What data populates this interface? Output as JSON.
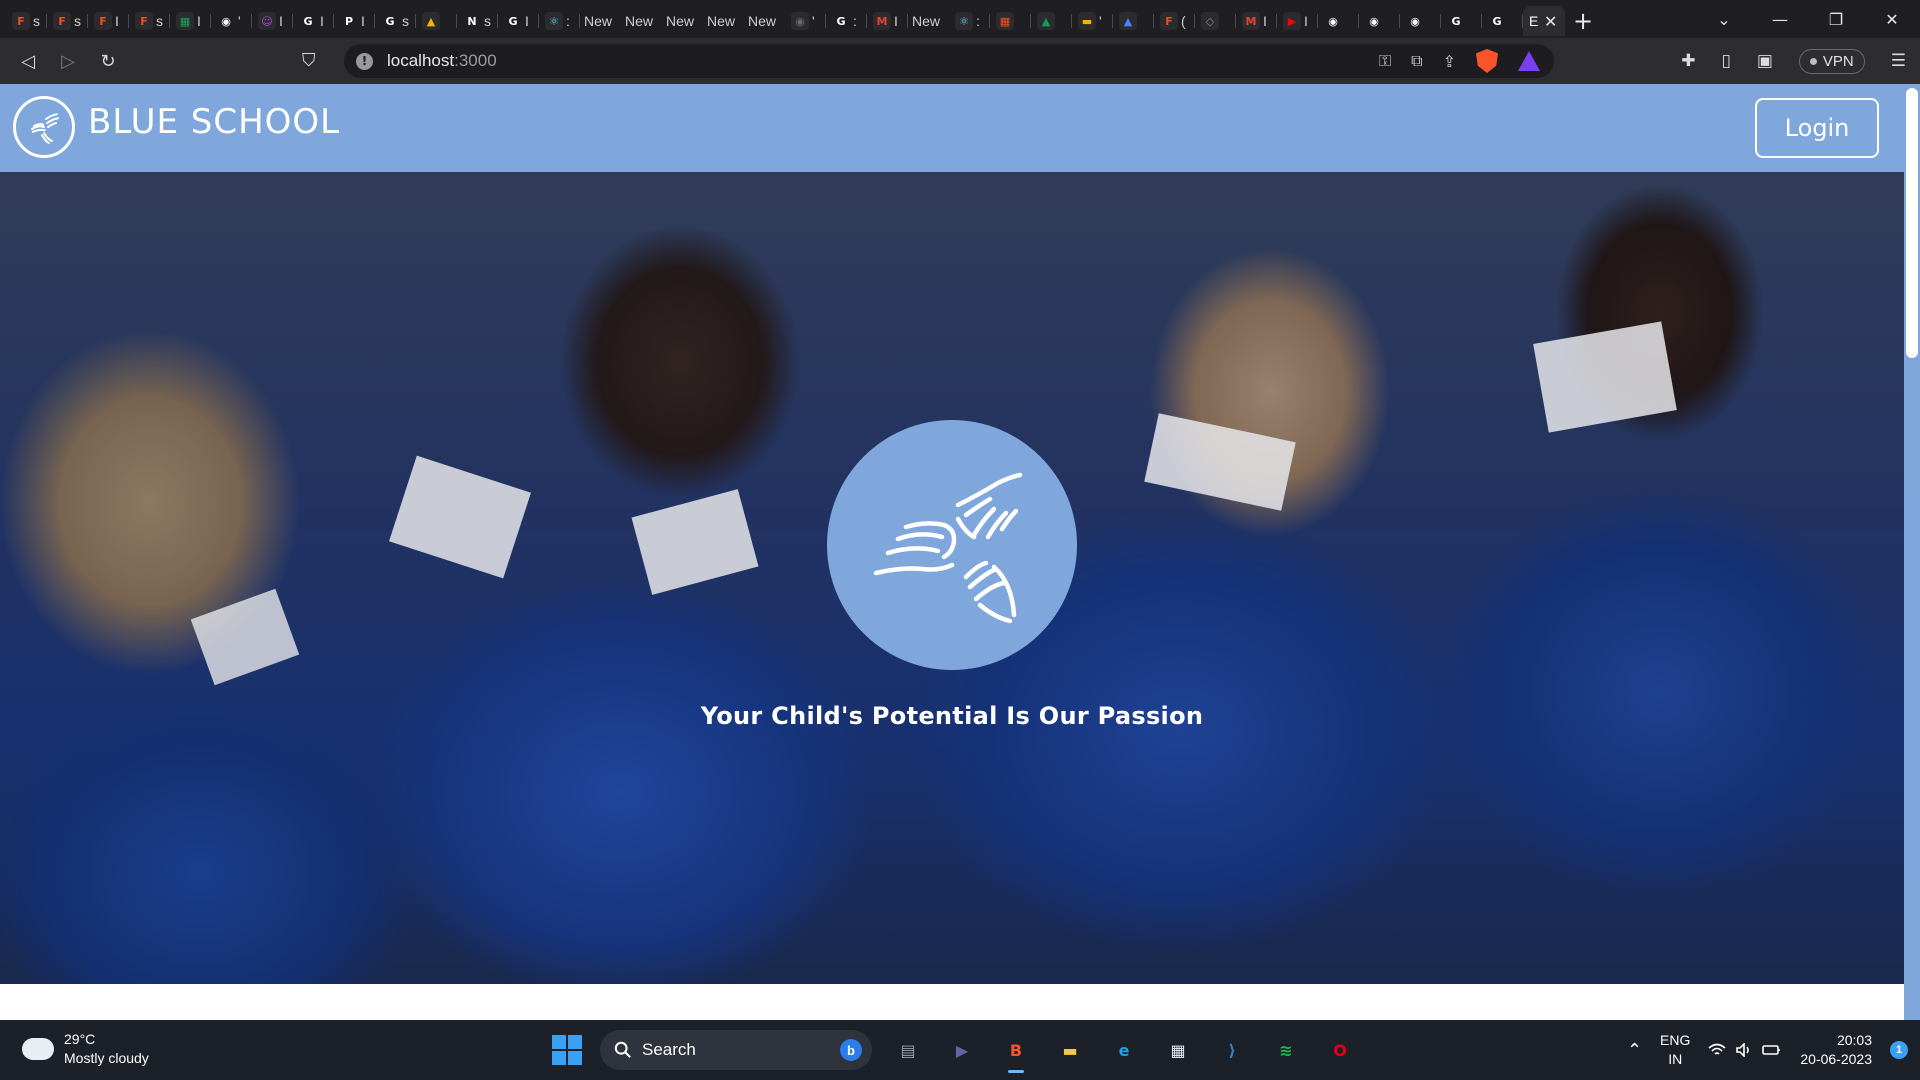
{
  "browser": {
    "tabs": [
      {
        "icon": "figma-icon",
        "color": "#f24e1e",
        "letter": "F",
        "label": "s"
      },
      {
        "icon": "figma-icon",
        "color": "#f24e1e",
        "letter": "F",
        "label": "s"
      },
      {
        "icon": "figma-icon",
        "color": "#f24e1e",
        "letter": "F",
        "label": "I"
      },
      {
        "icon": "figma-icon",
        "color": "#f24e1e",
        "letter": "F",
        "label": "s"
      },
      {
        "icon": "sheets-icon",
        "color": "#1aa260",
        "letter": "▦",
        "label": "I"
      },
      {
        "icon": "github-icon",
        "color": "#ffffff",
        "letter": "◉",
        "label": "'"
      },
      {
        "icon": "chat-icon",
        "color": "#b14bd8",
        "letter": "☺",
        "label": "I"
      },
      {
        "icon": "google-icon",
        "color": "#ffffff",
        "letter": "G",
        "label": "I"
      },
      {
        "icon": "p-icon",
        "color": "#ffffff",
        "letter": "P",
        "label": "I"
      },
      {
        "icon": "google-icon",
        "color": "#ffffff",
        "letter": "G",
        "label": "s"
      },
      {
        "icon": "drive-icon",
        "color": "#f4b400",
        "letter": "▲",
        "label": ""
      },
      {
        "icon": "notion-icon",
        "color": "#ffffff",
        "letter": "N",
        "label": "s"
      },
      {
        "icon": "google-icon",
        "color": "#ffffff",
        "letter": "G",
        "label": "I"
      },
      {
        "icon": "react-icon",
        "color": "#61dafb",
        "letter": "⚛",
        "label": ":"
      }
    ],
    "text_tabs": [
      "New",
      "New",
      "New",
      "New",
      "New"
    ],
    "tabs2": [
      {
        "icon": "github-icon",
        "color": "#6a6a6a",
        "letter": "◉",
        "label": "'"
      },
      {
        "icon": "google-icon",
        "color": "#ffffff",
        "letter": "G",
        "label": ":"
      },
      {
        "icon": "gmail-icon",
        "color": "#ea4335",
        "letter": "M",
        "label": "I"
      }
    ],
    "text_tab2": "New",
    "tabs3": [
      {
        "icon": "react-icon",
        "color": "#61dafb",
        "letter": "⚛",
        "label": ":"
      },
      {
        "icon": "microsoft-icon",
        "color": "#f25022",
        "letter": "▦",
        "label": ""
      },
      {
        "icon": "drive-icon",
        "color": "#0f9d58",
        "letter": "▲",
        "label": ""
      },
      {
        "icon": "slides-icon",
        "color": "#f4b400",
        "letter": "▬",
        "label": "'"
      },
      {
        "icon": "drive-icon",
        "color": "#4285f4",
        "letter": "▲",
        "label": ""
      },
      {
        "icon": "figma-icon",
        "color": "#f24e1e",
        "letter": "F",
        "label": "("
      },
      {
        "icon": "vercel-icon",
        "color": "#8a8a8a",
        "letter": "◇",
        "label": ""
      },
      {
        "icon": "gmail-icon",
        "color": "#ea4335",
        "letter": "M",
        "label": "I"
      },
      {
        "icon": "youtube-icon",
        "color": "#ff0000",
        "letter": "▶",
        "label": "I"
      },
      {
        "icon": "github-icon",
        "color": "#ffffff",
        "letter": "◉",
        "label": ""
      },
      {
        "icon": "github-icon",
        "color": "#ffffff",
        "letter": "◉",
        "label": ""
      },
      {
        "icon": "github-icon",
        "color": "#ffffff",
        "letter": "◉",
        "label": ""
      },
      {
        "icon": "google-icon",
        "color": "#ffffff",
        "letter": "G",
        "label": ""
      },
      {
        "icon": "google-icon",
        "color": "#ffffff",
        "letter": "G",
        "label": ""
      }
    ],
    "active_tab_label": "E",
    "new_tab_glyph": "+",
    "tab_list_glyph": "⌄",
    "window_controls": [
      "—",
      "❐",
      "✕"
    ],
    "back_glyph": "◁",
    "forward_glyph": "▷",
    "reload_glyph": "↻",
    "bookmark_glyph": "⛉",
    "url_host": "localhost",
    "url_port": ":3000",
    "addr_icons": [
      "⚿",
      "⧉",
      "⇪"
    ],
    "right_icons": [
      "✚",
      "▯",
      "▣"
    ],
    "vpn_label": "VPN",
    "menu_glyph": "☰"
  },
  "site": {
    "brand": "BLUE SCHOOL",
    "login_label": "Login",
    "tagline": "Your Child's Potential Is Our Passion",
    "brand_color": "#7fa7dc"
  },
  "taskbar": {
    "temperature": "29°C",
    "condition": "Mostly cloudy",
    "search_label": "Search",
    "apps": [
      {
        "name": "file-explorer-gray",
        "color": "#9aa0a6",
        "glyph": "▤"
      },
      {
        "name": "teams-chat",
        "color": "#6264a7",
        "glyph": "▶"
      },
      {
        "name": "brave",
        "color": "#fb542b",
        "glyph": "B"
      },
      {
        "name": "file-explorer",
        "color": "#f2c94c",
        "glyph": "▬"
      },
      {
        "name": "edge",
        "color": "#1fa2e0",
        "glyph": "e"
      },
      {
        "name": "store",
        "color": "#e9eef5",
        "glyph": "▦"
      },
      {
        "name": "vscode",
        "color": "#2b88d8",
        "glyph": "⟩"
      },
      {
        "name": "spotify",
        "color": "#1db954",
        "glyph": "≋"
      },
      {
        "name": "opera",
        "color": "#e0001b",
        "glyph": "O"
      }
    ],
    "lang_top": "ENG",
    "lang_bottom": "IN",
    "time": "20:03",
    "date": "20-06-2023",
    "notifications": "1",
    "tray_up_glyph": "⌃",
    "tray_icons": [
      "wifi",
      "speaker",
      "battery"
    ]
  }
}
